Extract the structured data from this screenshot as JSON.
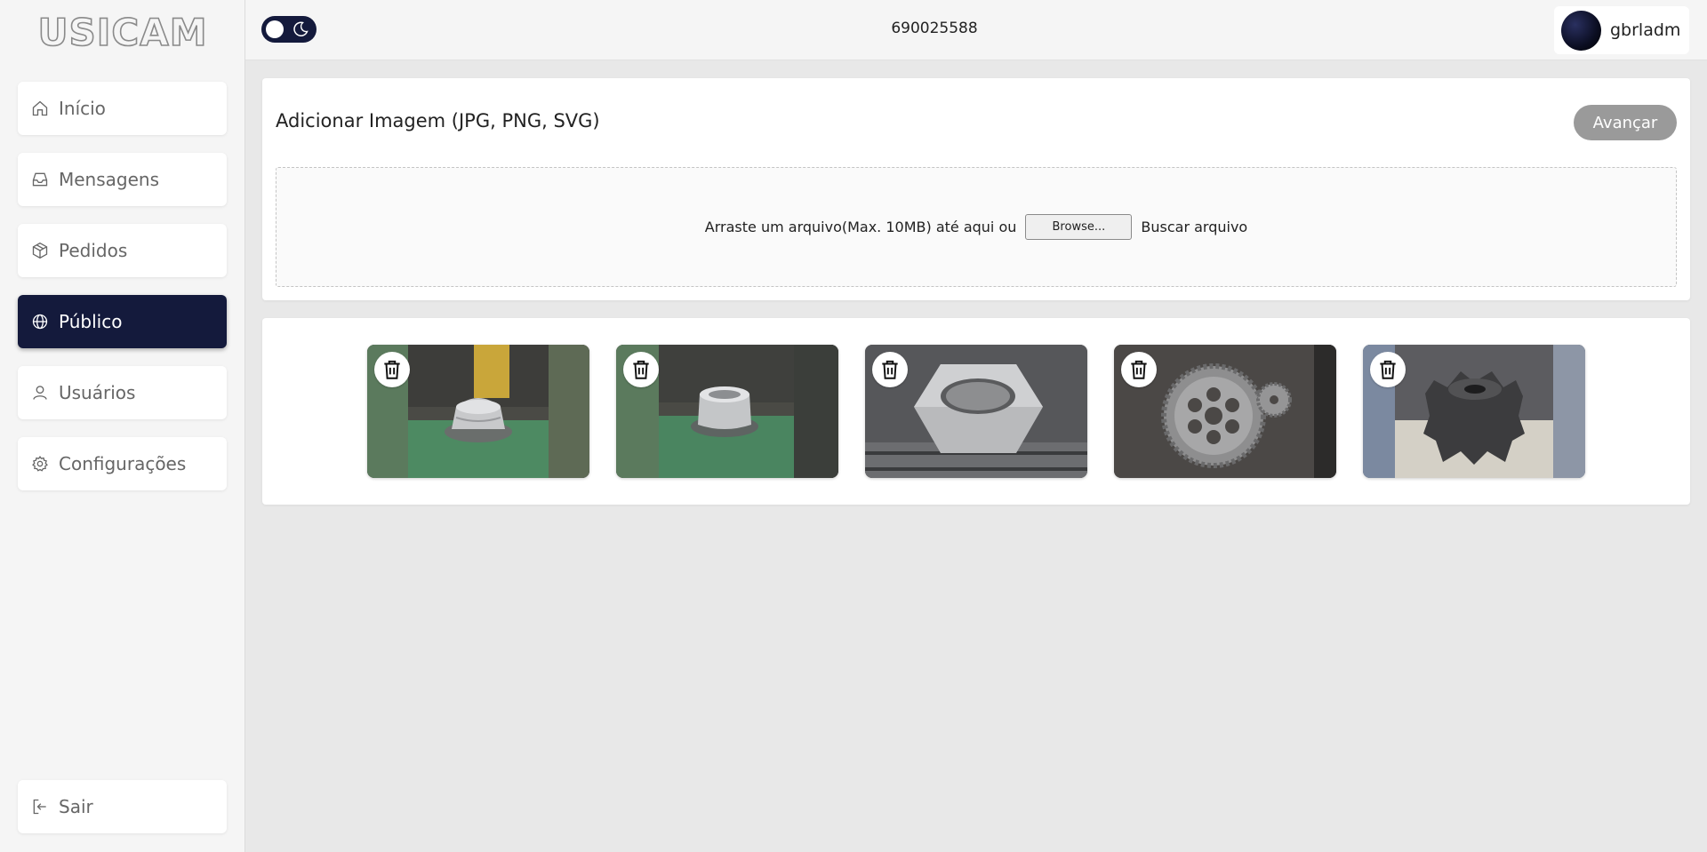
{
  "logo": "USICAM",
  "sidebar": {
    "items": [
      {
        "label": "Início",
        "icon": "home-icon"
      },
      {
        "label": "Mensagens",
        "icon": "inbox-icon"
      },
      {
        "label": "Pedidos",
        "icon": "package-icon"
      },
      {
        "label": "Público",
        "icon": "globe-icon"
      },
      {
        "label": "Usuários",
        "icon": "user-icon"
      },
      {
        "label": "Configurações",
        "icon": "gear-icon"
      }
    ],
    "logout": {
      "label": "Sair",
      "icon": "logout-icon"
    }
  },
  "topbar": {
    "theme_toggle": {
      "icon": "moon-icon",
      "dark": true
    },
    "code": "690025588",
    "user": {
      "name": "gbrladm"
    }
  },
  "upload": {
    "title": "Adicionar Imagem (JPG, PNG, SVG)",
    "advance_label": "Avançar",
    "drop_text": "Arraste um arquivo(Max. 10MB) até aqui ou",
    "browse_label": "Browse...",
    "search_label": "Buscar arquivo"
  },
  "gallery": {
    "images": [
      {
        "subject": "aluminum turned part on green lathe",
        "delete_icon": "trash-icon"
      },
      {
        "subject": "aluminum ring part on green lathe",
        "delete_icon": "trash-icon"
      },
      {
        "subject": "large hex nut on steel table",
        "delete_icon": "trash-icon"
      },
      {
        "subject": "gears on workbench",
        "delete_icon": "trash-icon"
      },
      {
        "subject": "dark pinion gear",
        "delete_icon": "trash-icon"
      }
    ]
  },
  "colors": {
    "accent": "#141a3c",
    "advance_button": "#9a9a9a",
    "background": "#e8e8e8"
  }
}
